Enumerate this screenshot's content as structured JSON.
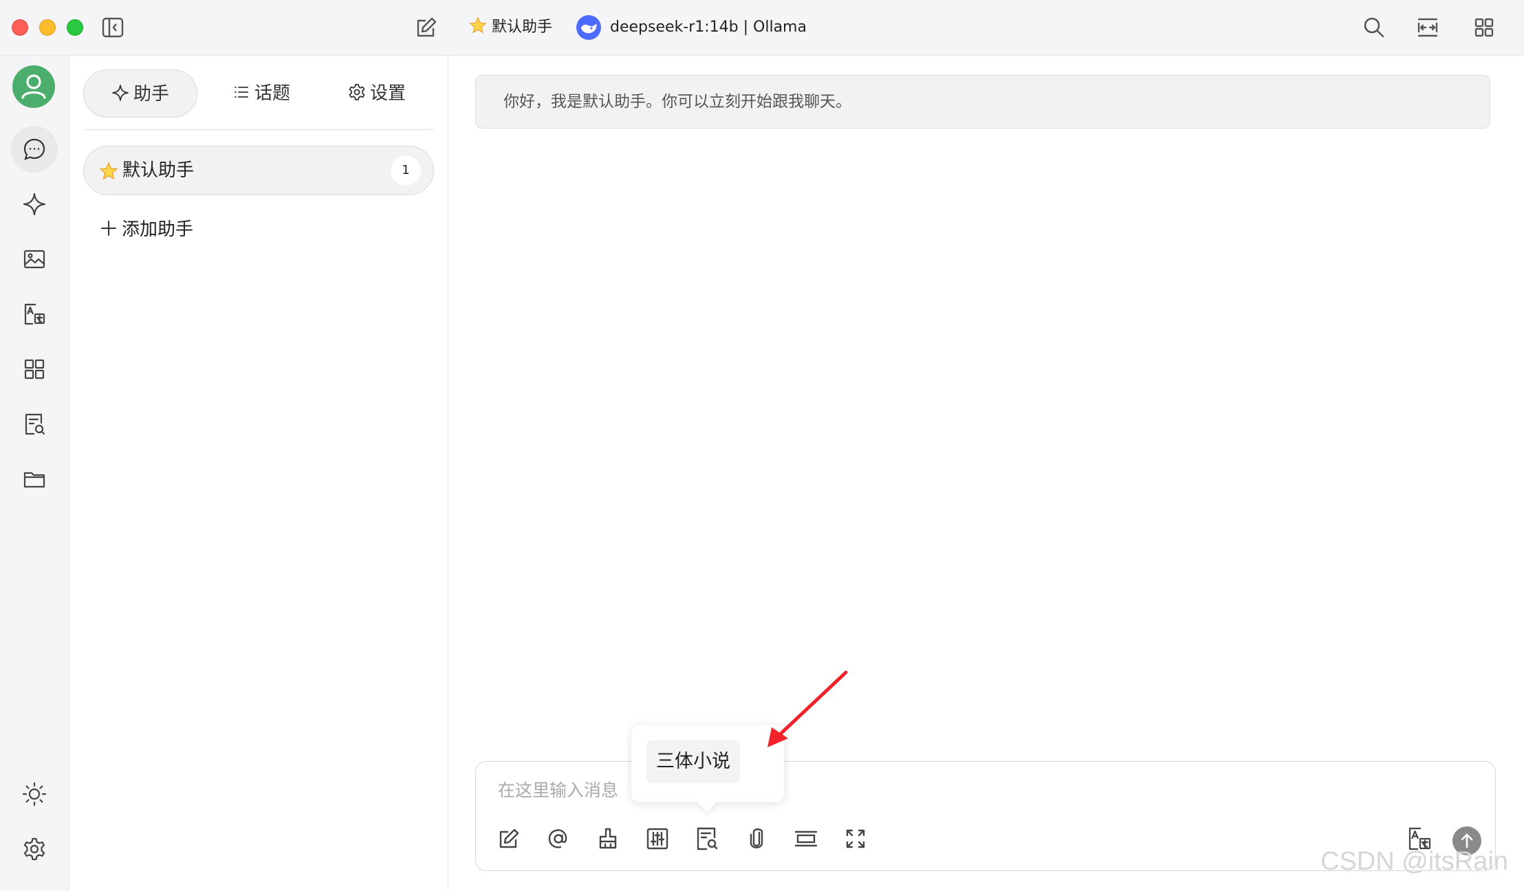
{
  "titlebar": {
    "assistant_title": "默认助手",
    "model_title": "deepseek-r1:14b | Ollama"
  },
  "panel": {
    "tabs": [
      {
        "label": "助手",
        "icon": "sparkle-icon"
      },
      {
        "label": "话题",
        "icon": "list-icon"
      },
      {
        "label": "设置",
        "icon": "gear-icon"
      }
    ],
    "assistants": [
      {
        "name": "默认助手",
        "count": "1",
        "icon": "star-icon"
      }
    ],
    "add_assistant_label": "添加助手"
  },
  "chat": {
    "greeting": "你好，我是默认助手。你可以立刻开始跟我聊天。",
    "input_placeholder": "在这里输入消息"
  },
  "tooltip": {
    "text": "三体小说"
  },
  "watermark": "CSDN @itsRain",
  "colors": {
    "avatar": "#4cae6c",
    "deepseek_logo": "#4d6bfe",
    "annotation_arrow": "#f0222a",
    "send_button": "#8a8a8a"
  }
}
